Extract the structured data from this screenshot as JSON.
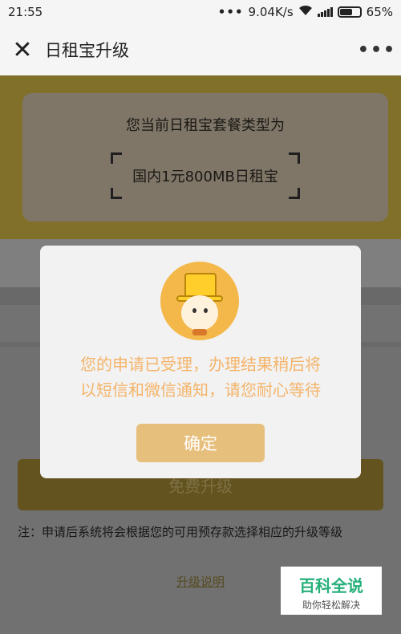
{
  "status_bar": {
    "time": "21:55",
    "dots": "•••",
    "network_speed": "9.04K/s",
    "battery_percent": "65%",
    "icons": [
      "wifi-icon",
      "signal-icon",
      "battery-icon"
    ]
  },
  "title_bar": {
    "close_icon": "close-icon",
    "title": "日租宝升级",
    "more_icon": "more-icon"
  },
  "plan_card": {
    "label": "您当前日租宝套餐类型为",
    "plan_name": "国内1元800MB日租宝"
  },
  "upgrade_button_label": "免费升级",
  "note": "注：申请后系统将会根据您的可用预存款选择相应的升级等级",
  "explain_link": "升级说明",
  "modal": {
    "message_line1": "您的申请已受理，办理结果稍后将",
    "message_line2": "以短信和微信通知，请您耐心等待",
    "confirm_label": "确定",
    "mascot_icon": "mascot-icon"
  },
  "watermark": {
    "title": "百科全说",
    "subtitle": "助你轻松解决"
  },
  "colors": {
    "gold": "#8d7a2e",
    "modal_text": "#f4b46a",
    "confirm_button": "#e7bf7d"
  }
}
